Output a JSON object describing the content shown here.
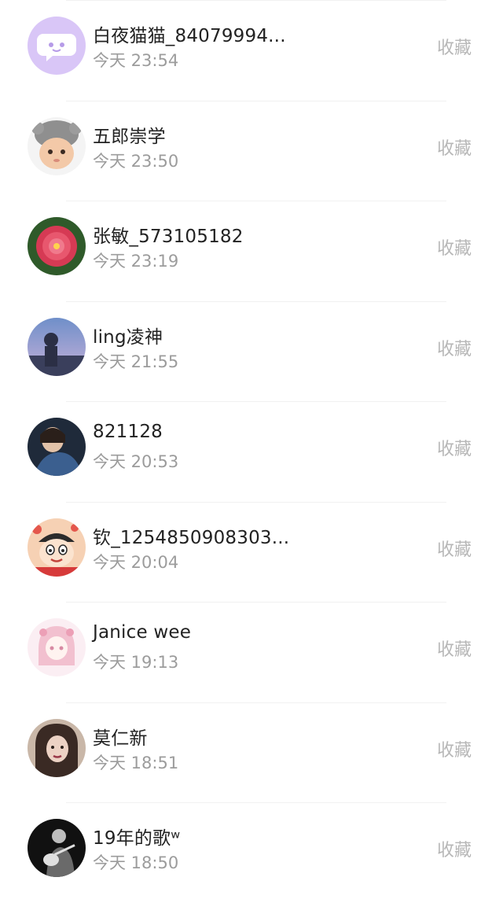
{
  "entries": [
    {
      "name": "白夜猫猫_84079994...",
      "time": "今天 23:54",
      "action": "收藏",
      "avatar": "cartoon-chat-bubble-avatar"
    },
    {
      "name": "五郎崇学",
      "time": "今天 23:50",
      "action": "收藏",
      "avatar": "baby-photo-avatar"
    },
    {
      "name": "张敏_573105182",
      "time": "今天 23:19",
      "action": "收藏",
      "avatar": "flower-photo-avatar"
    },
    {
      "name": "ling凌神",
      "time": "今天 21:55",
      "action": "收藏",
      "avatar": "night-sky-photo-avatar"
    },
    {
      "name": "821128",
      "time": "今天 20:53",
      "action": "收藏",
      "avatar": "person-photo-avatar"
    },
    {
      "name": "钦_1254850908303...",
      "time": "今天 20:04",
      "action": "收藏",
      "avatar": "cartoon-boy-avatar"
    },
    {
      "name": "Janice wee",
      "time": "今天 19:13",
      "action": "收藏",
      "avatar": "anime-girl-avatar"
    },
    {
      "name": "莫仁新",
      "time": "今天 18:51",
      "action": "收藏",
      "avatar": "portrait-photo-avatar"
    },
    {
      "name": "19年的歌ʷ",
      "time": "今天 18:50",
      "action": "收藏",
      "avatar": "guitar-player-photo-avatar"
    }
  ]
}
